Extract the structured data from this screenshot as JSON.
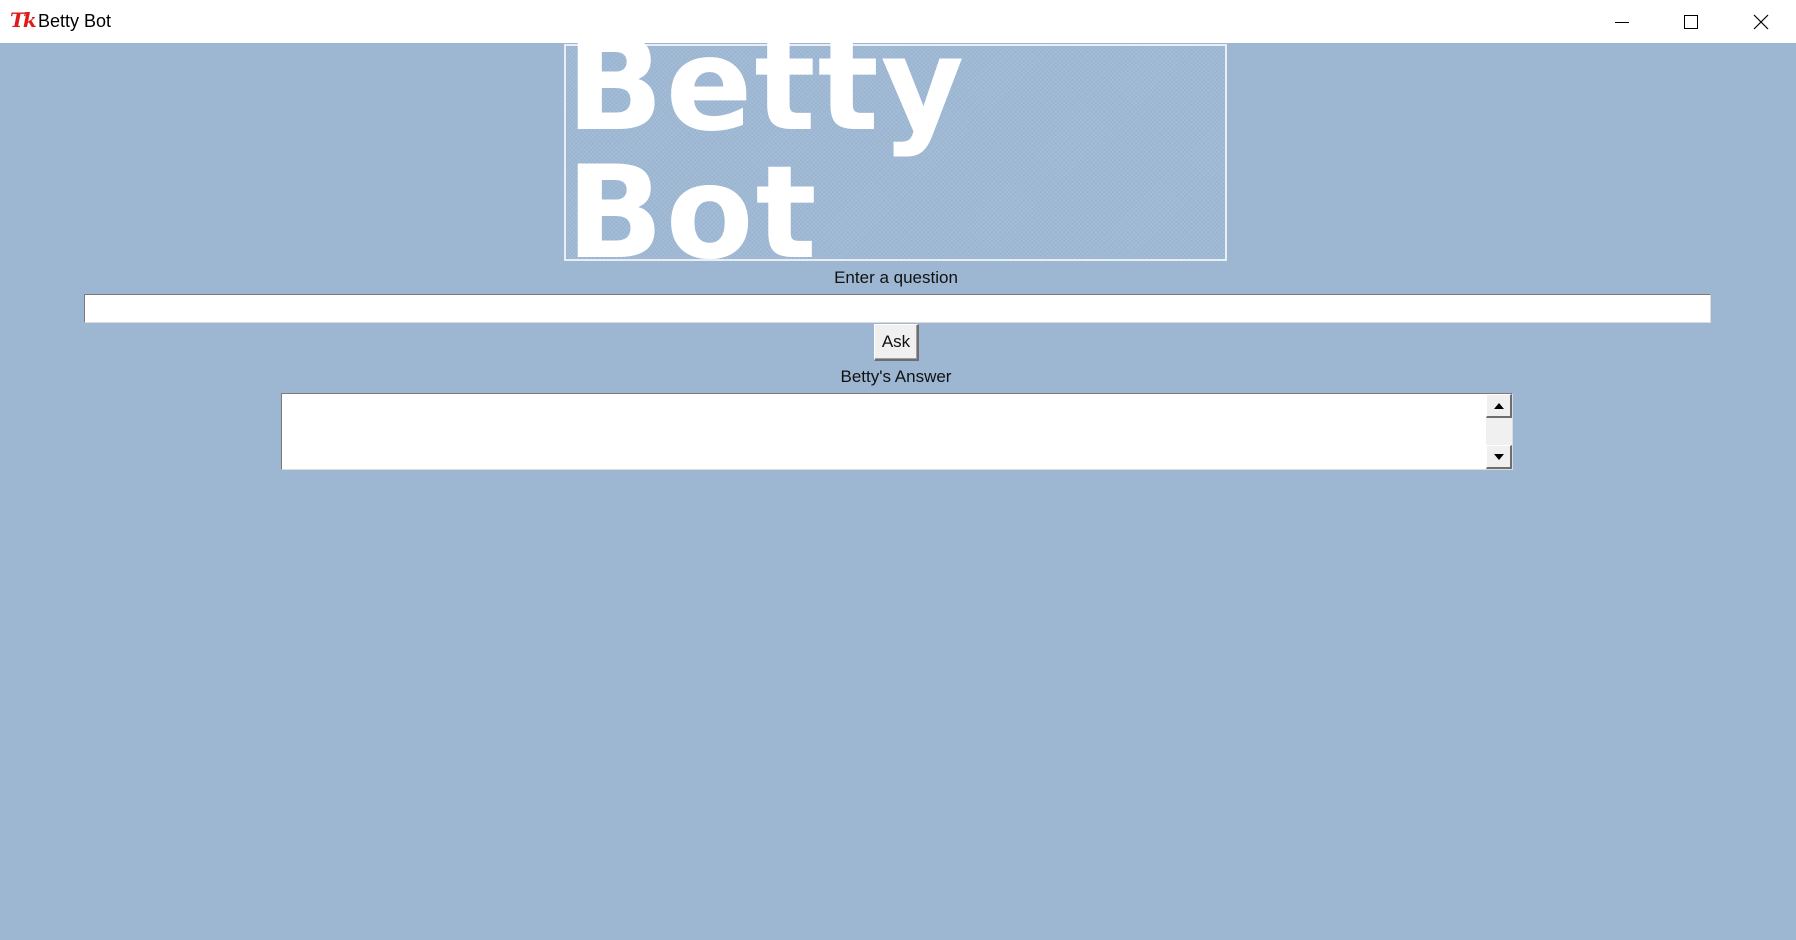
{
  "window": {
    "title": "Betty Bot",
    "app_icon": "tk-feather-icon",
    "controls": {
      "minimize": "minimize-icon",
      "maximize": "maximize-icon",
      "close": "close-icon"
    }
  },
  "banner": {
    "text": "Betty Bot"
  },
  "question": {
    "label": "Enter a question",
    "value": "",
    "placeholder": ""
  },
  "ask_button": {
    "label": "Ask"
  },
  "answer": {
    "label": "Betty's Answer",
    "text": ""
  },
  "colors": {
    "background": "#9db7d3",
    "banner_text": "#ffffff",
    "titlebar": "#ffffff"
  }
}
